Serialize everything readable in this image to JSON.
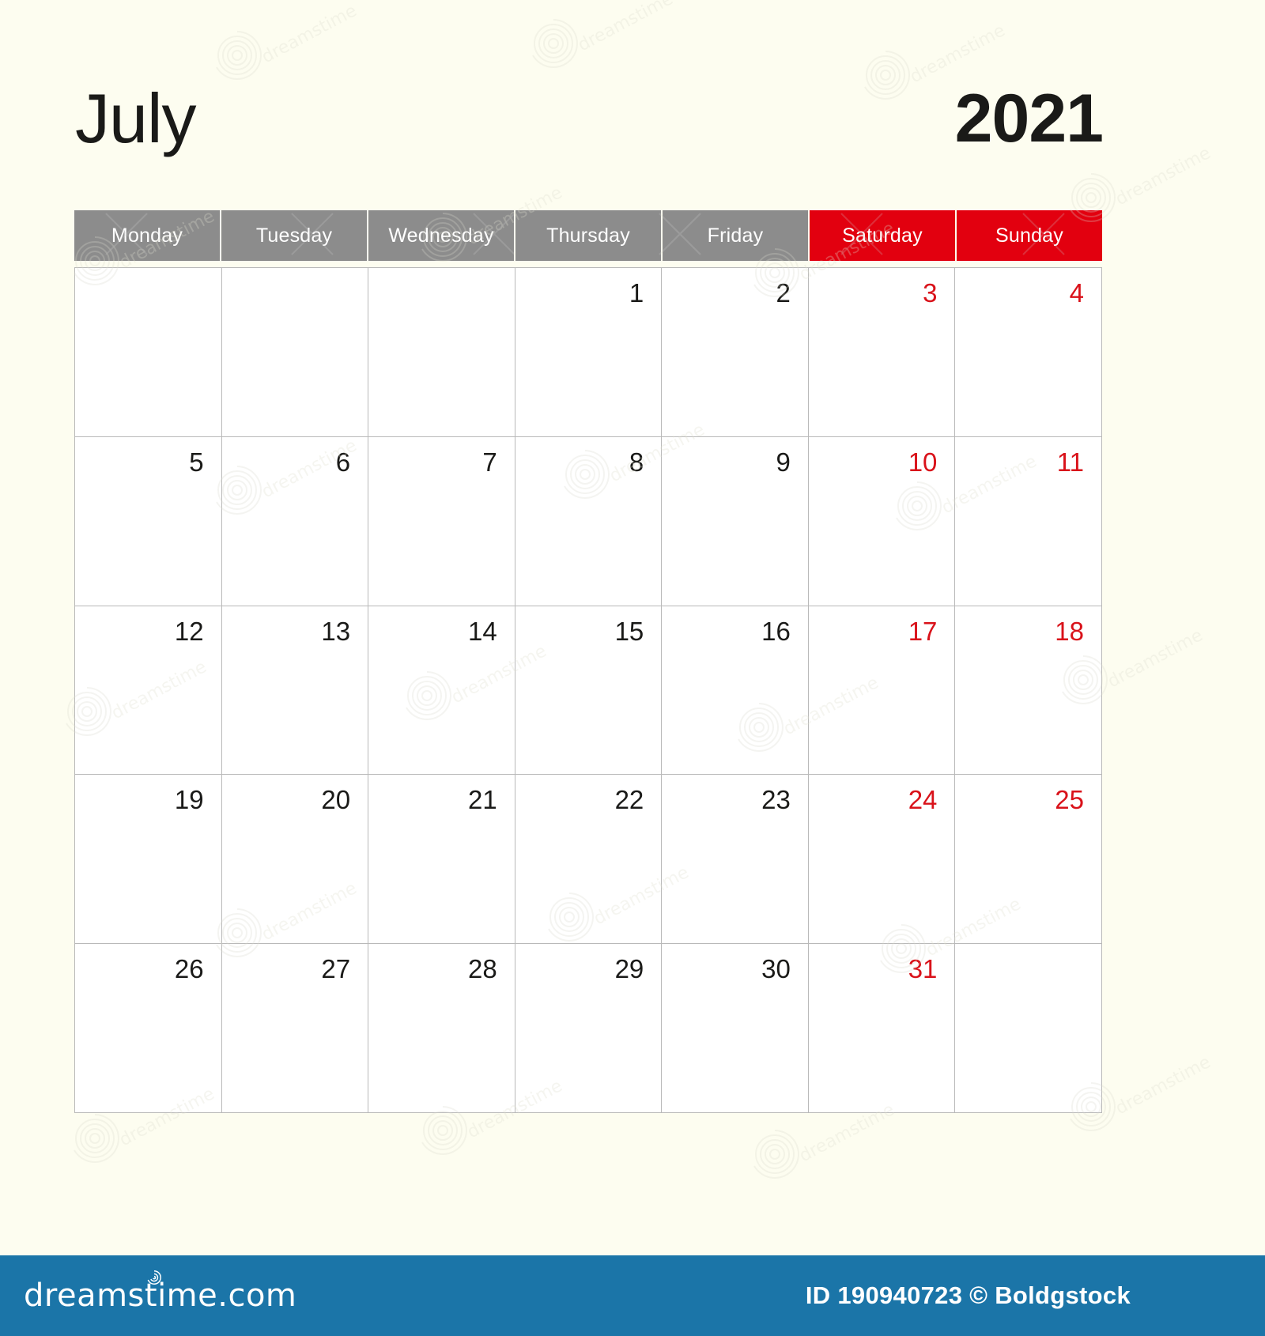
{
  "calendar": {
    "month": "July",
    "year": "2021",
    "weekdays": [
      {
        "label": "Monday",
        "type": "weekday"
      },
      {
        "label": "Tuesday",
        "type": "weekday"
      },
      {
        "label": "Wednesday",
        "type": "weekday"
      },
      {
        "label": "Thursday",
        "type": "weekday"
      },
      {
        "label": "Friday",
        "type": "weekday"
      },
      {
        "label": "Saturday",
        "type": "weekend"
      },
      {
        "label": "Sunday",
        "type": "weekend"
      }
    ],
    "weeks": [
      [
        {
          "day": "",
          "type": "empty"
        },
        {
          "day": "",
          "type": "empty"
        },
        {
          "day": "",
          "type": "empty"
        },
        {
          "day": "1",
          "type": "weekday"
        },
        {
          "day": "2",
          "type": "weekday"
        },
        {
          "day": "3",
          "type": "weekend"
        },
        {
          "day": "4",
          "type": "weekend"
        }
      ],
      [
        {
          "day": "5",
          "type": "weekday"
        },
        {
          "day": "6",
          "type": "weekday"
        },
        {
          "day": "7",
          "type": "weekday"
        },
        {
          "day": "8",
          "type": "weekday"
        },
        {
          "day": "9",
          "type": "weekday"
        },
        {
          "day": "10",
          "type": "weekend"
        },
        {
          "day": "11",
          "type": "weekend"
        }
      ],
      [
        {
          "day": "12",
          "type": "weekday"
        },
        {
          "day": "13",
          "type": "weekday"
        },
        {
          "day": "14",
          "type": "weekday"
        },
        {
          "day": "15",
          "type": "weekday"
        },
        {
          "day": "16",
          "type": "weekday"
        },
        {
          "day": "17",
          "type": "weekend"
        },
        {
          "day": "18",
          "type": "weekend"
        }
      ],
      [
        {
          "day": "19",
          "type": "weekday"
        },
        {
          "day": "20",
          "type": "weekday"
        },
        {
          "day": "21",
          "type": "weekday"
        },
        {
          "day": "22",
          "type": "weekday"
        },
        {
          "day": "23",
          "type": "weekday"
        },
        {
          "day": "24",
          "type": "weekend"
        },
        {
          "day": "25",
          "type": "weekend"
        }
      ],
      [
        {
          "day": "26",
          "type": "weekday"
        },
        {
          "day": "27",
          "type": "weekday"
        },
        {
          "day": "28",
          "type": "weekday"
        },
        {
          "day": "29",
          "type": "weekday"
        },
        {
          "day": "30",
          "type": "weekday"
        },
        {
          "day": "31",
          "type": "weekend"
        },
        {
          "day": "",
          "type": "empty"
        }
      ]
    ]
  },
  "footer": {
    "brand": "dreamstime.com",
    "credit": "ID 190940723 © Boldgstock"
  },
  "colors": {
    "page_background": "#fdfdf0",
    "weekday_header": "#8c8c8c",
    "weekend_header": "#e2000f",
    "weekend_date_text": "#d9121a",
    "weekday_date_text": "#1a1a18",
    "cell_border": "#b9b9b9",
    "cell_background": "#ffffff",
    "footer_background": "#1b75a8"
  },
  "watermark": {
    "text": "dreamstime"
  }
}
